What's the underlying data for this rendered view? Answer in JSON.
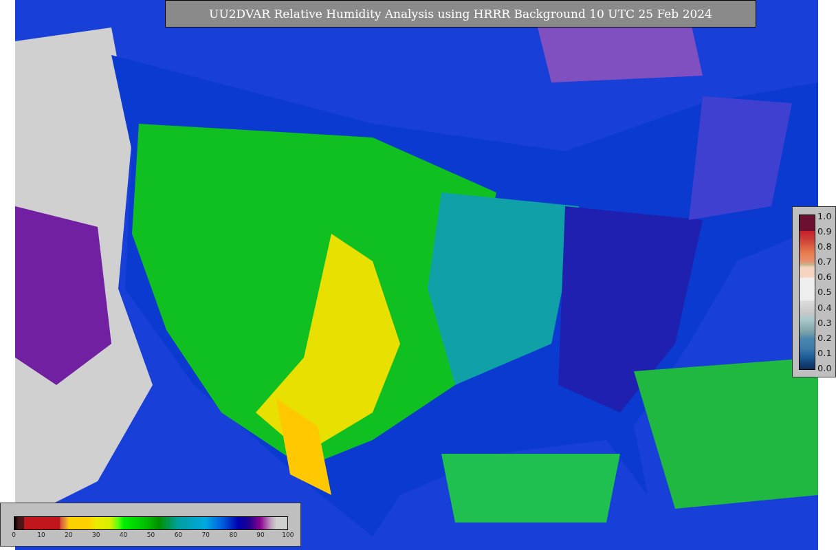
{
  "title": "UU2DVAR Relative Humidity Analysis using HRRR Background 10 UTC 25 Feb 2024",
  "humidity_legend": {
    "ticks": [
      "0",
      "10",
      "20",
      "30",
      "40",
      "50",
      "60",
      "70",
      "80",
      "90",
      "100"
    ]
  },
  "observation_legend": {
    "ticks": [
      "1.0",
      "0.9",
      "0.8",
      "0.7",
      "0.6",
      "0.5",
      "0.4",
      "0.3",
      "0.2",
      "0.1",
      "0.0"
    ]
  }
}
